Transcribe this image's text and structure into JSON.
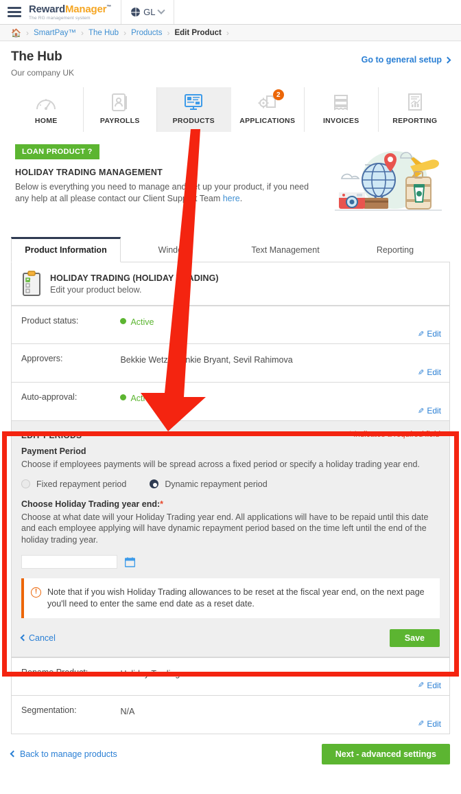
{
  "topbar": {
    "menu_icon": "hamburger-icon",
    "brand_part1": "Reward",
    "brand_part2": "Manager",
    "brand_tm": "™",
    "brand_tagline": "The RG management system",
    "lang_icon": "globe-icon",
    "lang_label": "GL",
    "lang_chevron": "chevron-down-icon"
  },
  "breadcrumb": {
    "home_icon": "home-icon",
    "items": [
      {
        "label": "SmartPay™",
        "current": false
      },
      {
        "label": "The Hub",
        "current": false
      },
      {
        "label": "Products",
        "current": false
      },
      {
        "label": "Edit Product",
        "current": true
      }
    ],
    "separator": "›"
  },
  "header": {
    "title": "The Hub",
    "subtitle": "Our company UK",
    "general_setup_label": "Go to general setup",
    "general_setup_icon": "chevron-right-icon"
  },
  "nav": {
    "items": [
      {
        "label": "HOME",
        "icon": "speedometer-icon",
        "active": false,
        "badge": ""
      },
      {
        "label": "PAYROLLS",
        "icon": "contact-card-icon",
        "active": false,
        "badge": ""
      },
      {
        "label": "PRODUCTS",
        "icon": "monitor-icon",
        "active": true,
        "badge": ""
      },
      {
        "label": "APPLICATIONS",
        "icon": "gear-document-icon",
        "active": false,
        "badge": "2"
      },
      {
        "label": "INVOICES",
        "icon": "invoice-icon",
        "active": false,
        "badge": ""
      },
      {
        "label": "REPORTING",
        "icon": "report-chart-icon",
        "active": false,
        "badge": ""
      }
    ]
  },
  "promo": {
    "tag": "LOAN PRODUCT ?",
    "heading": "HOLIDAY TRADING MANAGEMENT",
    "body_before": "Below is everything you need to manage and set up your product, if you need any help at all please contact our Client Support Team ",
    "link": "here",
    "body_after": ".",
    "illustration": "travel-luggage-globe-illustration"
  },
  "tabs": [
    {
      "label": "Product Information",
      "active": true
    },
    {
      "label": "Windows",
      "active": false
    },
    {
      "label": "Text Management",
      "active": false
    },
    {
      "label": "Reporting",
      "active": false
    }
  ],
  "product_box": {
    "icon": "clipboard-icon",
    "heading": "HOLIDAY TRADING (HOLIDAY TRADING)",
    "subtext": "Edit your product below."
  },
  "rows_top": [
    {
      "label": "Product status:",
      "value": "Active",
      "status": true,
      "edit": "Edit"
    },
    {
      "label": "Approvers:",
      "value": "Bekkie Wetz, Frankie Bryant, Sevil Rahimova",
      "status": false,
      "edit": "Edit"
    },
    {
      "label": "Auto-approval:",
      "value": "Active",
      "status": true,
      "edit": "Edit"
    }
  ],
  "edit_periods": {
    "title": "EDIT PERIODS",
    "required_note": "* Indicates a required field",
    "payment_period_label": "Payment Period",
    "payment_period_desc": "Choose if employees payments will be spread across a fixed period or specify a holiday trading year end.",
    "radios": [
      {
        "label": "Fixed repayment period",
        "selected": false
      },
      {
        "label": "Dynamic repayment period",
        "selected": true
      }
    ],
    "year_end_label": "Choose Holiday Trading year end:",
    "year_end_required": "*",
    "year_end_desc": "Choose at what date will your Holiday Trading year end. All applications will have to be repaid until this date and each employee applying will have dynamic repayment period based on the time left until the end of the holiday trading year.",
    "date_value": "",
    "date_placeholder": "",
    "calendar_icon": "calendar-icon",
    "note_icon": "exclamation-circle-icon",
    "note_text": "Note that if you wish Holiday Trading allowances to be reset at the fiscal year end, on the next page you'll need to enter the same end date as a reset date.",
    "cancel_label": "Cancel",
    "cancel_icon": "chevron-left-icon",
    "save_label": "Save"
  },
  "rows_bottom": [
    {
      "label": "Rename Product:",
      "value": "Holiday Trading",
      "edit": "Edit"
    },
    {
      "label": "Segmentation:",
      "value": "N/A",
      "edit": "Edit"
    }
  ],
  "footer": {
    "back_label": "Back to manage products",
    "back_icon": "chevron-left-icon",
    "next_label": "Next - advanced settings"
  },
  "annotations": {
    "arrow": "red-arrow-pointing-to-edit-periods",
    "highlight_box": "red-rectangle-around-edit-periods"
  },
  "colors": {
    "brand_navy": "#3b4a63",
    "brand_orange": "#f5a623",
    "link_blue": "#2a7fd4",
    "green": "#5cb531",
    "badge_orange": "#ec6608",
    "annotation_red": "#f42410",
    "required_red": "#e8472b"
  }
}
